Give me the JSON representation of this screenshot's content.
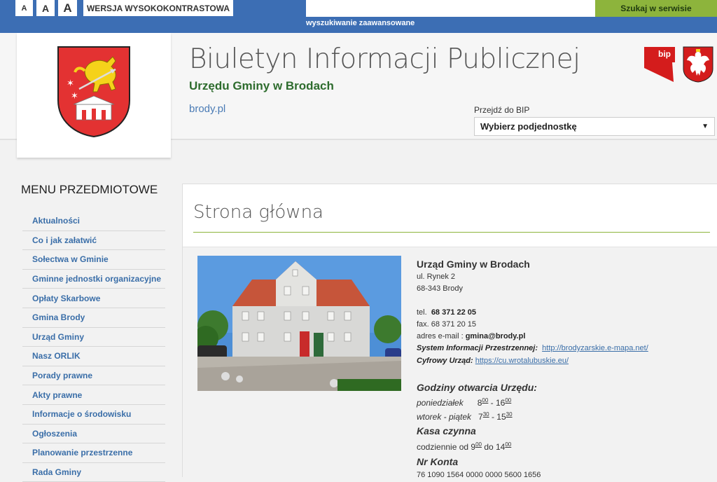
{
  "topbar": {
    "font_small": "A",
    "font_medium": "A",
    "font_large": "A",
    "contrast_label": "WERSJA WYSOKOKONTRASTOWA",
    "search_placeholder": "",
    "search_button": "Szukaj w serwisie",
    "advanced_search": "wyszukiwanie zaawansowane"
  },
  "header": {
    "title": "Biuletyn Informacji Publicznej",
    "subtitle": "Urzędu Gminy w Brodach",
    "site": "brody.pl",
    "bip_logo_text": "bip",
    "goto_label": "Przejdź do BIP",
    "goto_select": "Wybierz podjednostkę"
  },
  "sidebar": {
    "title": "MENU PRZEDMIOTOWE",
    "items": [
      "Aktualności",
      "Co i jak załatwić",
      "Sołectwa w Gminie",
      "Gminne jednostki organizacyjne",
      "Opłaty Skarbowe",
      "Gmina Brody",
      "Urząd Gminy",
      "Nasz ORLIK",
      "Porady prawne",
      "Akty prawne",
      "Informacje o środowisku",
      "Ogłoszenia",
      "Planowanie przestrzenne",
      "Rada Gminy"
    ]
  },
  "main": {
    "page_title": "Strona główna",
    "office": {
      "name": "Urząd Gminy w Brodach",
      "street": "ul. Rynek 2",
      "city": "68-343 Brody",
      "tel_label": "tel.",
      "tel": "68 371 22 05",
      "fax": "fax. 68 371 20 15",
      "email_label": "adres e-mail :",
      "email": "gmina@brody.pl",
      "sip_label": "System Informacji Przestrzennej:",
      "sip_url": "http://brodyzarskie.e-mapa.net/",
      "cu_label": "Cyfrowy Urząd:",
      "cu_url": "https://cu.wrotalubuskie.eu/"
    },
    "hours": {
      "title": "Godziny otwarcia Urzędu:",
      "mon_label": "poniedziałek",
      "mon_from": "8",
      "mon_from_min": "00",
      "mon_sep": " - 16",
      "mon_to_min": "00",
      "tf_label": "wtorek - piątek",
      "tf_from": "7",
      "tf_from_min": "30",
      "tf_sep": " - 15",
      "tf_to_min": "30"
    },
    "cashier": {
      "title": "Kasa czynna",
      "text_a": "codziennie od 9",
      "from_min": "00",
      "text_b": " do 14",
      "to_min": "00"
    },
    "account": {
      "title": "Nr Konta",
      "number": "76 1090 1564 0000 0000 5600 1656"
    }
  }
}
